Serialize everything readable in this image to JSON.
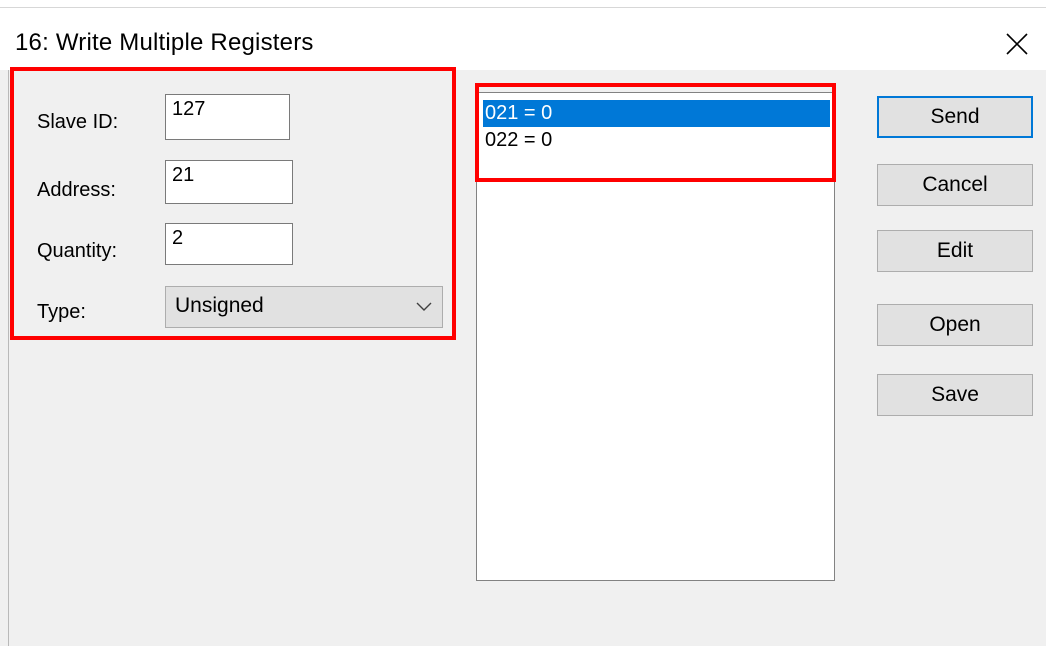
{
  "dialog": {
    "title": "16: Write Multiple Registers"
  },
  "form": {
    "slave_id": {
      "label": "Slave ID:",
      "value": "127"
    },
    "address": {
      "label": "Address:",
      "value": "21"
    },
    "quantity": {
      "label": "Quantity:",
      "value": "2"
    },
    "type": {
      "label": "Type:",
      "value": "Unsigned"
    }
  },
  "register_list": [
    {
      "text": "021 = 0",
      "selected": true
    },
    {
      "text": "022 = 0",
      "selected": false
    }
  ],
  "buttons": {
    "send": "Send",
    "cancel": "Cancel",
    "edit": "Edit",
    "open": "Open",
    "save": "Save"
  },
  "colors": {
    "selection": "#0078d7",
    "highlight_box": "#ff0000",
    "dialog_background": "#f0f0f0"
  },
  "icons": {
    "close": "close-icon",
    "dropdown": "chevron-down-icon"
  }
}
